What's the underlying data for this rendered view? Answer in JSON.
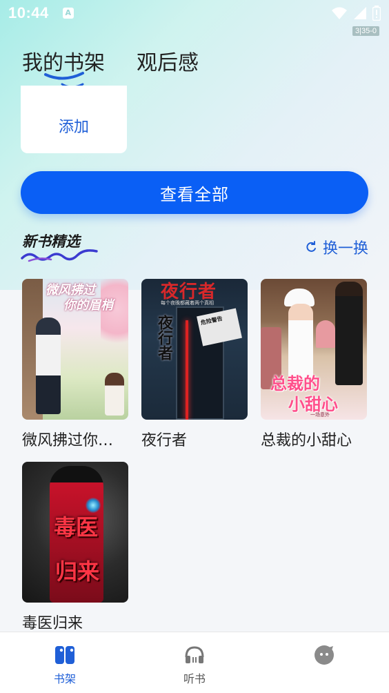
{
  "status_bar": {
    "time": "10:44",
    "frame_badge": "3|35-0"
  },
  "tabs": [
    {
      "label": "我的书架",
      "active": true
    },
    {
      "label": "观后感",
      "active": false
    }
  ],
  "shelf": {
    "add_label": "添加",
    "view_all_label": "查看全部"
  },
  "new_books": {
    "title": "新书精选",
    "refresh_label": "换一换",
    "books": [
      {
        "title": "微风拂过你…",
        "cover_text": "微风拂过你的眉梢",
        "cover_text_1": "微风拂过",
        "cover_text_2": "你的眉梢"
      },
      {
        "title": "夜行者",
        "cover_text": "夜行者",
        "cover_small": "每个夜晚都藏着两个真相",
        "cover_vertical": "夜行者",
        "cover_note": "危险警告"
      },
      {
        "title": "总裁的小甜心",
        "cover_text_1": "总裁的",
        "cover_text_2": "小甜心",
        "cover_small": "一场意外"
      },
      {
        "title": "毒医归来",
        "cover_text_1": "毒医",
        "cover_text_2": "归来"
      }
    ]
  },
  "bottom_nav": [
    {
      "label": "书架",
      "icon": "bookshelf-icon",
      "active": true
    },
    {
      "label": "听书",
      "icon": "headphones-icon",
      "active": false
    },
    {
      "label": "",
      "icon": "profile-face-icon",
      "active": false
    }
  ],
  "colors": {
    "accent": "#0a5ff5",
    "accent_text": "#1f5fd7"
  }
}
